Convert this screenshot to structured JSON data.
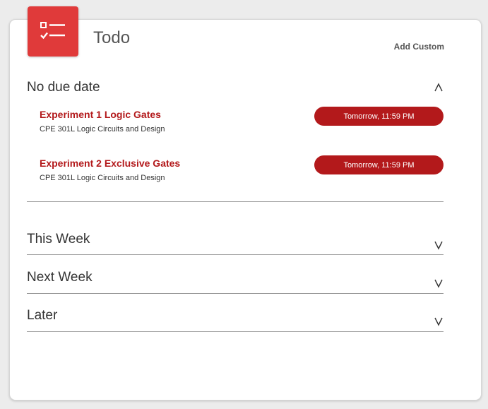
{
  "header": {
    "icon": "todo-checklist-icon",
    "title": "Todo",
    "add_custom_label": "Add Custom"
  },
  "colors": {
    "accent": "#e03a3a",
    "item_title": "#b3191b",
    "due_pill": "#b3191b"
  },
  "sections": [
    {
      "label": "No due date",
      "expanded": true,
      "chevron": "chevron-up-icon",
      "items": [
        {
          "title": "Experiment 1 Logic Gates",
          "course": "CPE 301L Logic Circuits and Design",
          "due": "Tomorrow, 11:59 PM"
        },
        {
          "title": "Experiment 2 Exclusive Gates",
          "course": "CPE 301L Logic Circuits and Design",
          "due": "Tomorrow, 11:59 PM"
        }
      ]
    },
    {
      "label": "This Week",
      "expanded": false,
      "chevron": "chevron-down-icon"
    },
    {
      "label": "Next Week",
      "expanded": false,
      "chevron": "chevron-down-icon"
    },
    {
      "label": "Later",
      "expanded": false,
      "chevron": "chevron-down-icon"
    }
  ]
}
